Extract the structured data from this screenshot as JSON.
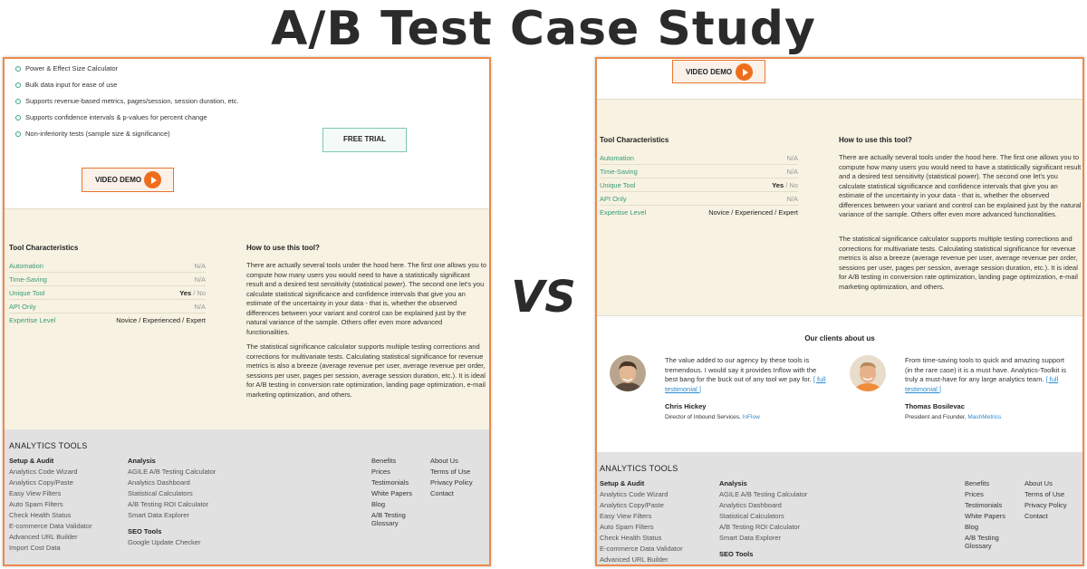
{
  "title": "A/B Test Case Study",
  "vs": "VS",
  "colors": {
    "accent_orange": "#ee6e1c",
    "border_orange": "#ec8a4a",
    "green": "#3a9a78",
    "beige": "#f7f2e1",
    "footer_gray": "#e1e1e1"
  },
  "features": [
    "Power & Effect Size Calculator",
    "Bulk data input for ease of use",
    "Supports revenue-based metrics, pages/session, session duration, etc.",
    "Supports confidence intervals & p-values for percent change",
    "Non-inferiority tests (sample size & significance)"
  ],
  "buttons": {
    "free_trial": "FREE TRIAL",
    "video_demo": "VIDEO DEMO",
    "play_icon": "play-icon"
  },
  "characteristics": {
    "title": "Tool Characteristics",
    "rows": [
      {
        "key": "Automation",
        "value": "N/A"
      },
      {
        "key": "Time-Saving",
        "value": "N/A"
      },
      {
        "key": "Unique Tool",
        "value_yes": "Yes",
        "value_sep": " / ",
        "value_no": "No"
      },
      {
        "key": "API Only",
        "value": "N/A"
      },
      {
        "key": "Expertise Level",
        "value": "Novice / Experienced / Expert"
      }
    ]
  },
  "how_to": {
    "title": "How to use this tool?",
    "p1": "There are actually several tools under the hood here. The first one allows you to compute how many users you would need to have a statistically significant result and a desired test sensitivity (statistical power). The second one let's you calculate statistical significance and confidence intervals that give you an estimate of the uncertainty in your data - that is, whether the observed differences between your variant and control can be explained just by the natural variance of the sample. Others offer even more advanced functionalities.",
    "p2": "The statistical significance calculator supports multiple testing corrections and corrections for multivariate tests. Calculating statistical significance for revenue metrics is also a breeze (average revenue per user, average revenue per order, sessions per user, pages per session, average session duration, etc.). It is ideal for A/B testing in conversion rate optimization, landing page optimization, e-mail marketing optimization, and others."
  },
  "clients": {
    "title": "Our clients about us",
    "items": [
      {
        "quote": "The value added to our agency by these tools is tremendous. I would say it provides Inflow with the best bang for the buck out of any tool we pay for.",
        "more": "[ full testimonial ]",
        "name": "Chris Hickey",
        "role": "Director of Inbound Services,",
        "company": "InFlow"
      },
      {
        "quote": "From time-saving tools to quick and amazing support (in the rare case) it is a must have. Analytics-Toolkit is truly a must-have for any large analytics team.",
        "more": "[ full testimonial ]",
        "name": "Thomas Bosilevac",
        "role": "President and Founder,",
        "company": "MashMetrics"
      }
    ]
  },
  "footer": {
    "heading": "ANALYTICS TOOLS",
    "setup_title": "Setup & Audit",
    "setup": [
      "Analytics Code Wizard",
      "Analytics Copy/Paste",
      "Easy View Filters",
      "Auto Spam Filters",
      "Check Health Status",
      "E-commerce Data Validator",
      "Advanced URL Builder",
      "Import Cost Data"
    ],
    "analysis_title": "Analysis",
    "analysis": [
      "AGILE A/B Testing Calculator",
      "Analytics Dashboard",
      "Statistical Calculators",
      "A/B Testing ROI Calculator",
      "Smart Data Explorer"
    ],
    "seo_title": "SEO Tools",
    "seo": [
      "Google Update Checker"
    ],
    "links1": [
      "Benefits",
      "Prices",
      "Testimonials",
      "White Papers",
      "Blog"
    ],
    "links1_last_a": "A/B Testing",
    "links1_last_b": "Glossary",
    "links2": [
      "About Us",
      "Terms of Use",
      "Privacy Policy",
      "Contact"
    ]
  }
}
